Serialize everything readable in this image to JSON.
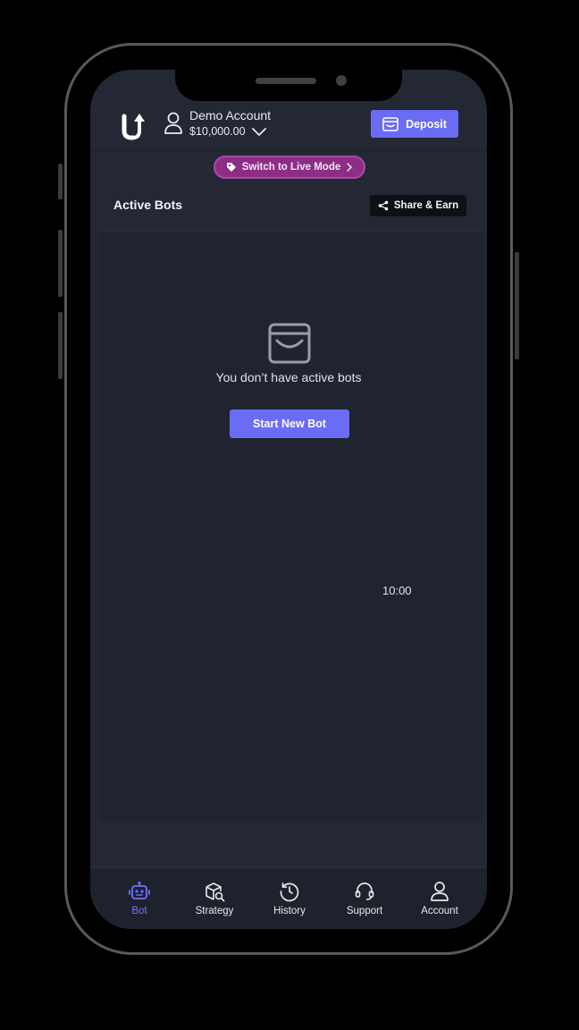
{
  "header": {
    "account_name": "Demo Account",
    "account_balance": "$10,000.00",
    "deposit_label": "Deposit"
  },
  "live_mode": {
    "label": "Switch to Live Mode"
  },
  "active_bots": {
    "title": "Active Bots",
    "share_label": "Share & Earn",
    "empty_message": "You don’t have active bots",
    "start_label": "Start New Bot"
  },
  "clock": "10:00",
  "nav": {
    "items": [
      {
        "label": "Bot",
        "icon": "robot-icon",
        "active": true
      },
      {
        "label": "Strategy",
        "icon": "strategy-icon",
        "active": false
      },
      {
        "label": "History",
        "icon": "history-icon",
        "active": false
      },
      {
        "label": "Support",
        "icon": "headset-icon",
        "active": false
      },
      {
        "label": "Account",
        "icon": "user-icon",
        "active": false
      }
    ]
  },
  "colors": {
    "accent": "#6a6cf5",
    "live_mode": "#8e2d86",
    "background": "#232834"
  }
}
